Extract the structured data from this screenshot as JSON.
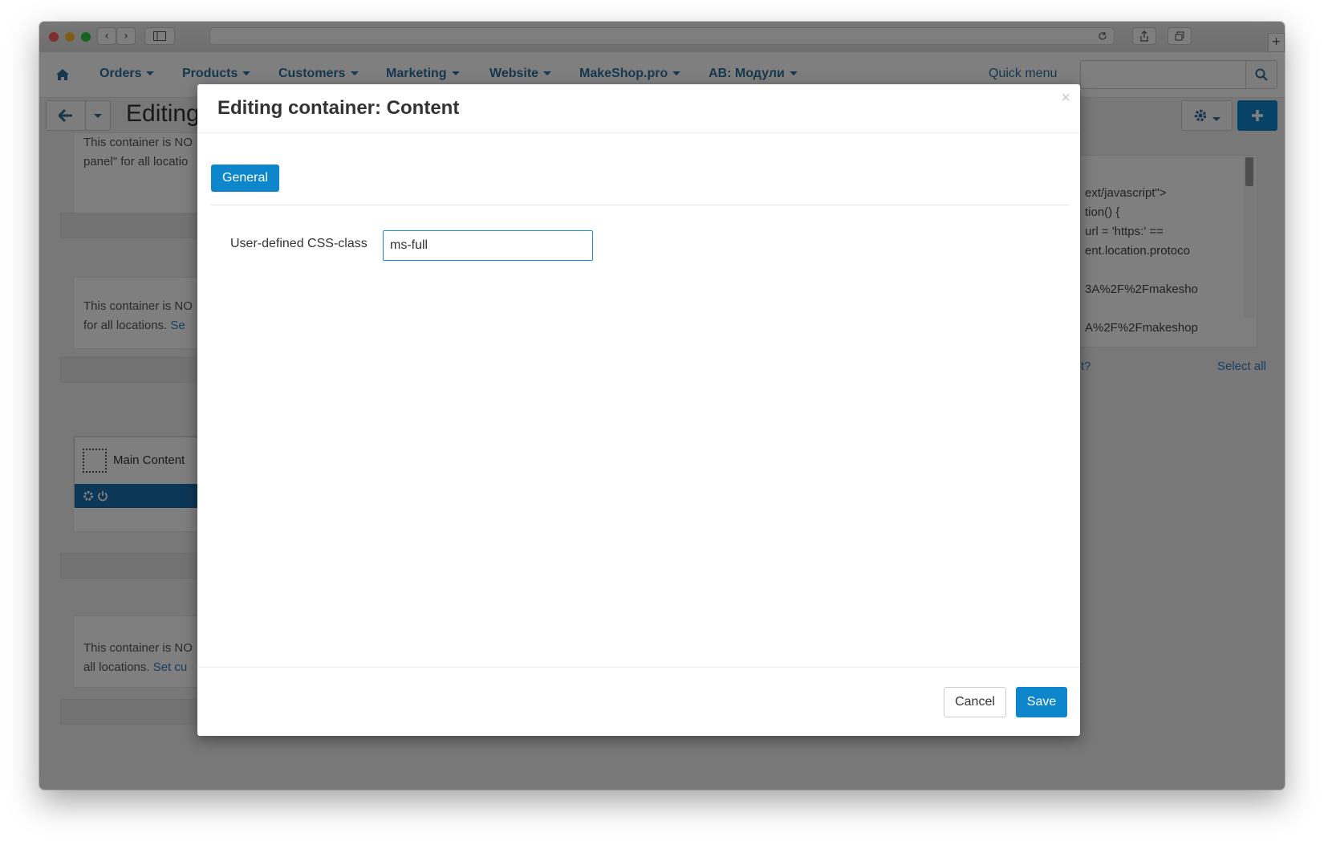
{
  "browser": {
    "nav_back": "‹",
    "nav_forward": "›"
  },
  "navbar": {
    "items": [
      "Orders",
      "Products",
      "Customers",
      "Marketing",
      "Website",
      "MakeShop.pro",
      "AB: Модули"
    ],
    "quick_menu": "Quick menu",
    "search_placeholder": ""
  },
  "page": {
    "title": "Editing",
    "notice_1_line1": "This container is NO",
    "notice_1_line2": "panel\" for all locatio",
    "notice_2_line1": "This container is NO",
    "notice_2_line2": "for all locations.",
    "notice_2_link": "Se",
    "block_name": "Main Content",
    "notice_3_line1": "This container is NO",
    "notice_3_line2": "all locations.",
    "notice_3_link": "Set cu",
    "code_lines": [
      "ext/javascript\">",
      "tion() {",
      "url = 'https:' ==",
      "ent.location.protoco",
      "3A%2F%2Fmakesho",
      "A%2F%2Fmakeshop"
    ],
    "partial_link": "t?",
    "select_all": "Select all"
  },
  "modal": {
    "title": "Editing container: Content",
    "close": "×",
    "tab_general": "General",
    "css_label": "User-defined CSS-class",
    "css_value": "ms-full",
    "cancel": "Cancel",
    "save": "Save"
  },
  "colors": {
    "accent": "#0e86cc",
    "nav_text": "#2d6e9a",
    "block_bar": "#1b6fae"
  }
}
